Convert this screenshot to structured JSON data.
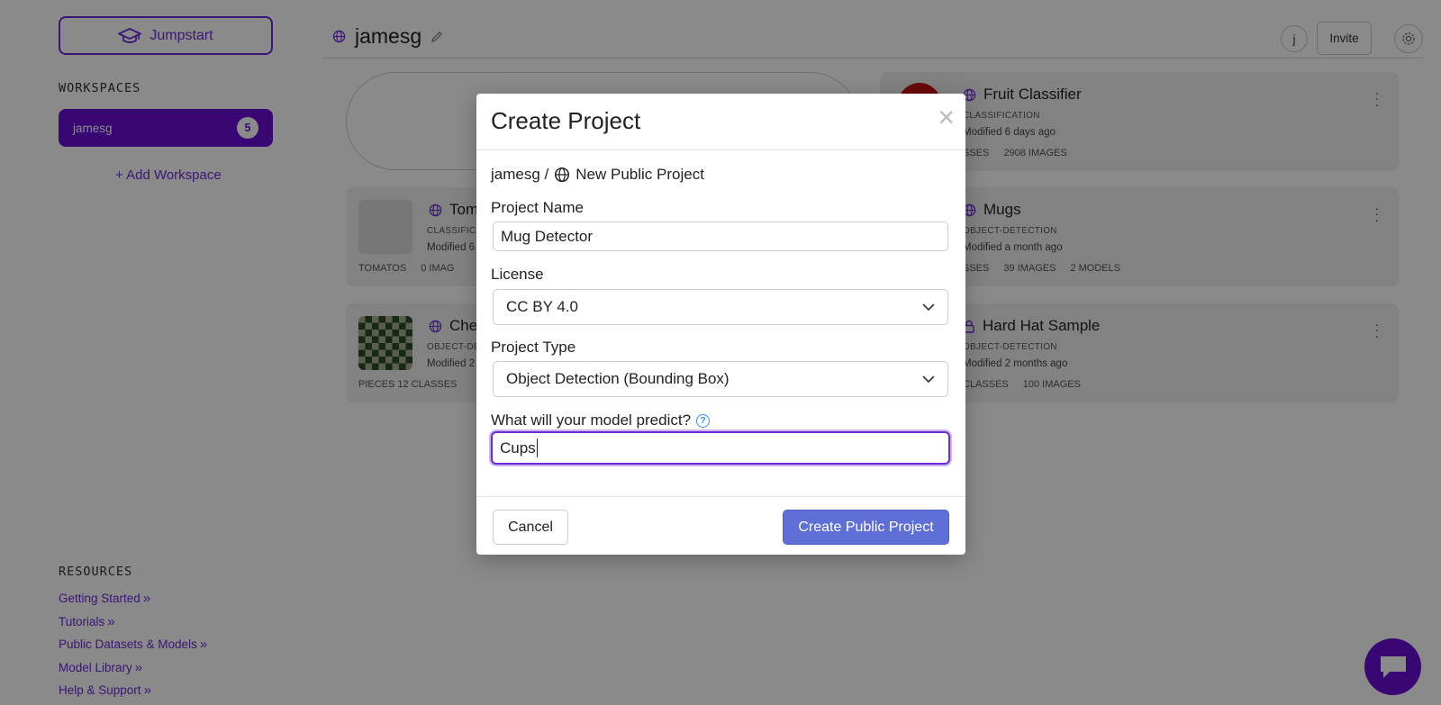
{
  "sidebar": {
    "jumpstart_label": "Jumpstart",
    "workspaces_title": "WORKSPACES",
    "workspace": {
      "name": "jamesg",
      "count": "5"
    },
    "add_workspace_label": "+ Add Workspace",
    "resources_title": "RESOURCES",
    "resources": [
      {
        "label": "Getting Started"
      },
      {
        "label": "Tutorials"
      },
      {
        "label": "Public Datasets & Models"
      },
      {
        "label": "Model Library"
      },
      {
        "label": "Help & Support"
      }
    ]
  },
  "header": {
    "workspace_name": "jamesg",
    "avatar_letter": "j",
    "invite_label": "Invite"
  },
  "projects": [
    {
      "title": "Fruit Classifier",
      "type": "CLASSIFICATION",
      "modified": "Modified 6 days ago",
      "stats": [
        "SSES",
        "2908 IMAGES"
      ]
    },
    {
      "title": "Tom",
      "type": "CLASSIFICA",
      "modified": "Modified 6",
      "stats": [
        "TOMATOS",
        "0 IMAG"
      ]
    },
    {
      "title": "Mugs",
      "type": "OBJECT-DETECTION",
      "modified": "Modified a month ago",
      "stats": [
        "SSES",
        "39 IMAGES",
        "2 MODELS"
      ]
    },
    {
      "title": "Che",
      "type": "OBJECT-DE",
      "modified": "Modified 2",
      "stats": [
        "PIECES 12 CLASSES"
      ]
    },
    {
      "title": "Hard Hat Sample",
      "type": "OBJECT-DETECTION",
      "modified": "Modified 2 months ago",
      "stats": [
        "CLASSES",
        "100 IMAGES"
      ]
    }
  ],
  "modal": {
    "title": "Create Project",
    "close_glyph": "×",
    "breadcrumb_workspace": "jamesg /",
    "breadcrumb_project": "New Public Project",
    "project_name_label": "Project Name",
    "project_name_value": "Mug Detector",
    "license_label": "License",
    "license_value": "CC BY 4.0",
    "project_type_label": "Project Type",
    "project_type_value": "Object Detection (Bounding Box)",
    "predict_label": "What will your model predict?",
    "predict_help_glyph": "?",
    "predict_value": "Cups",
    "cancel_label": "Cancel",
    "create_label": "Create Public Project"
  },
  "colors": {
    "accent_purple": "#6c2bd9",
    "create_button": "#5f6fd8",
    "help_blue": "#2e8ee8"
  }
}
